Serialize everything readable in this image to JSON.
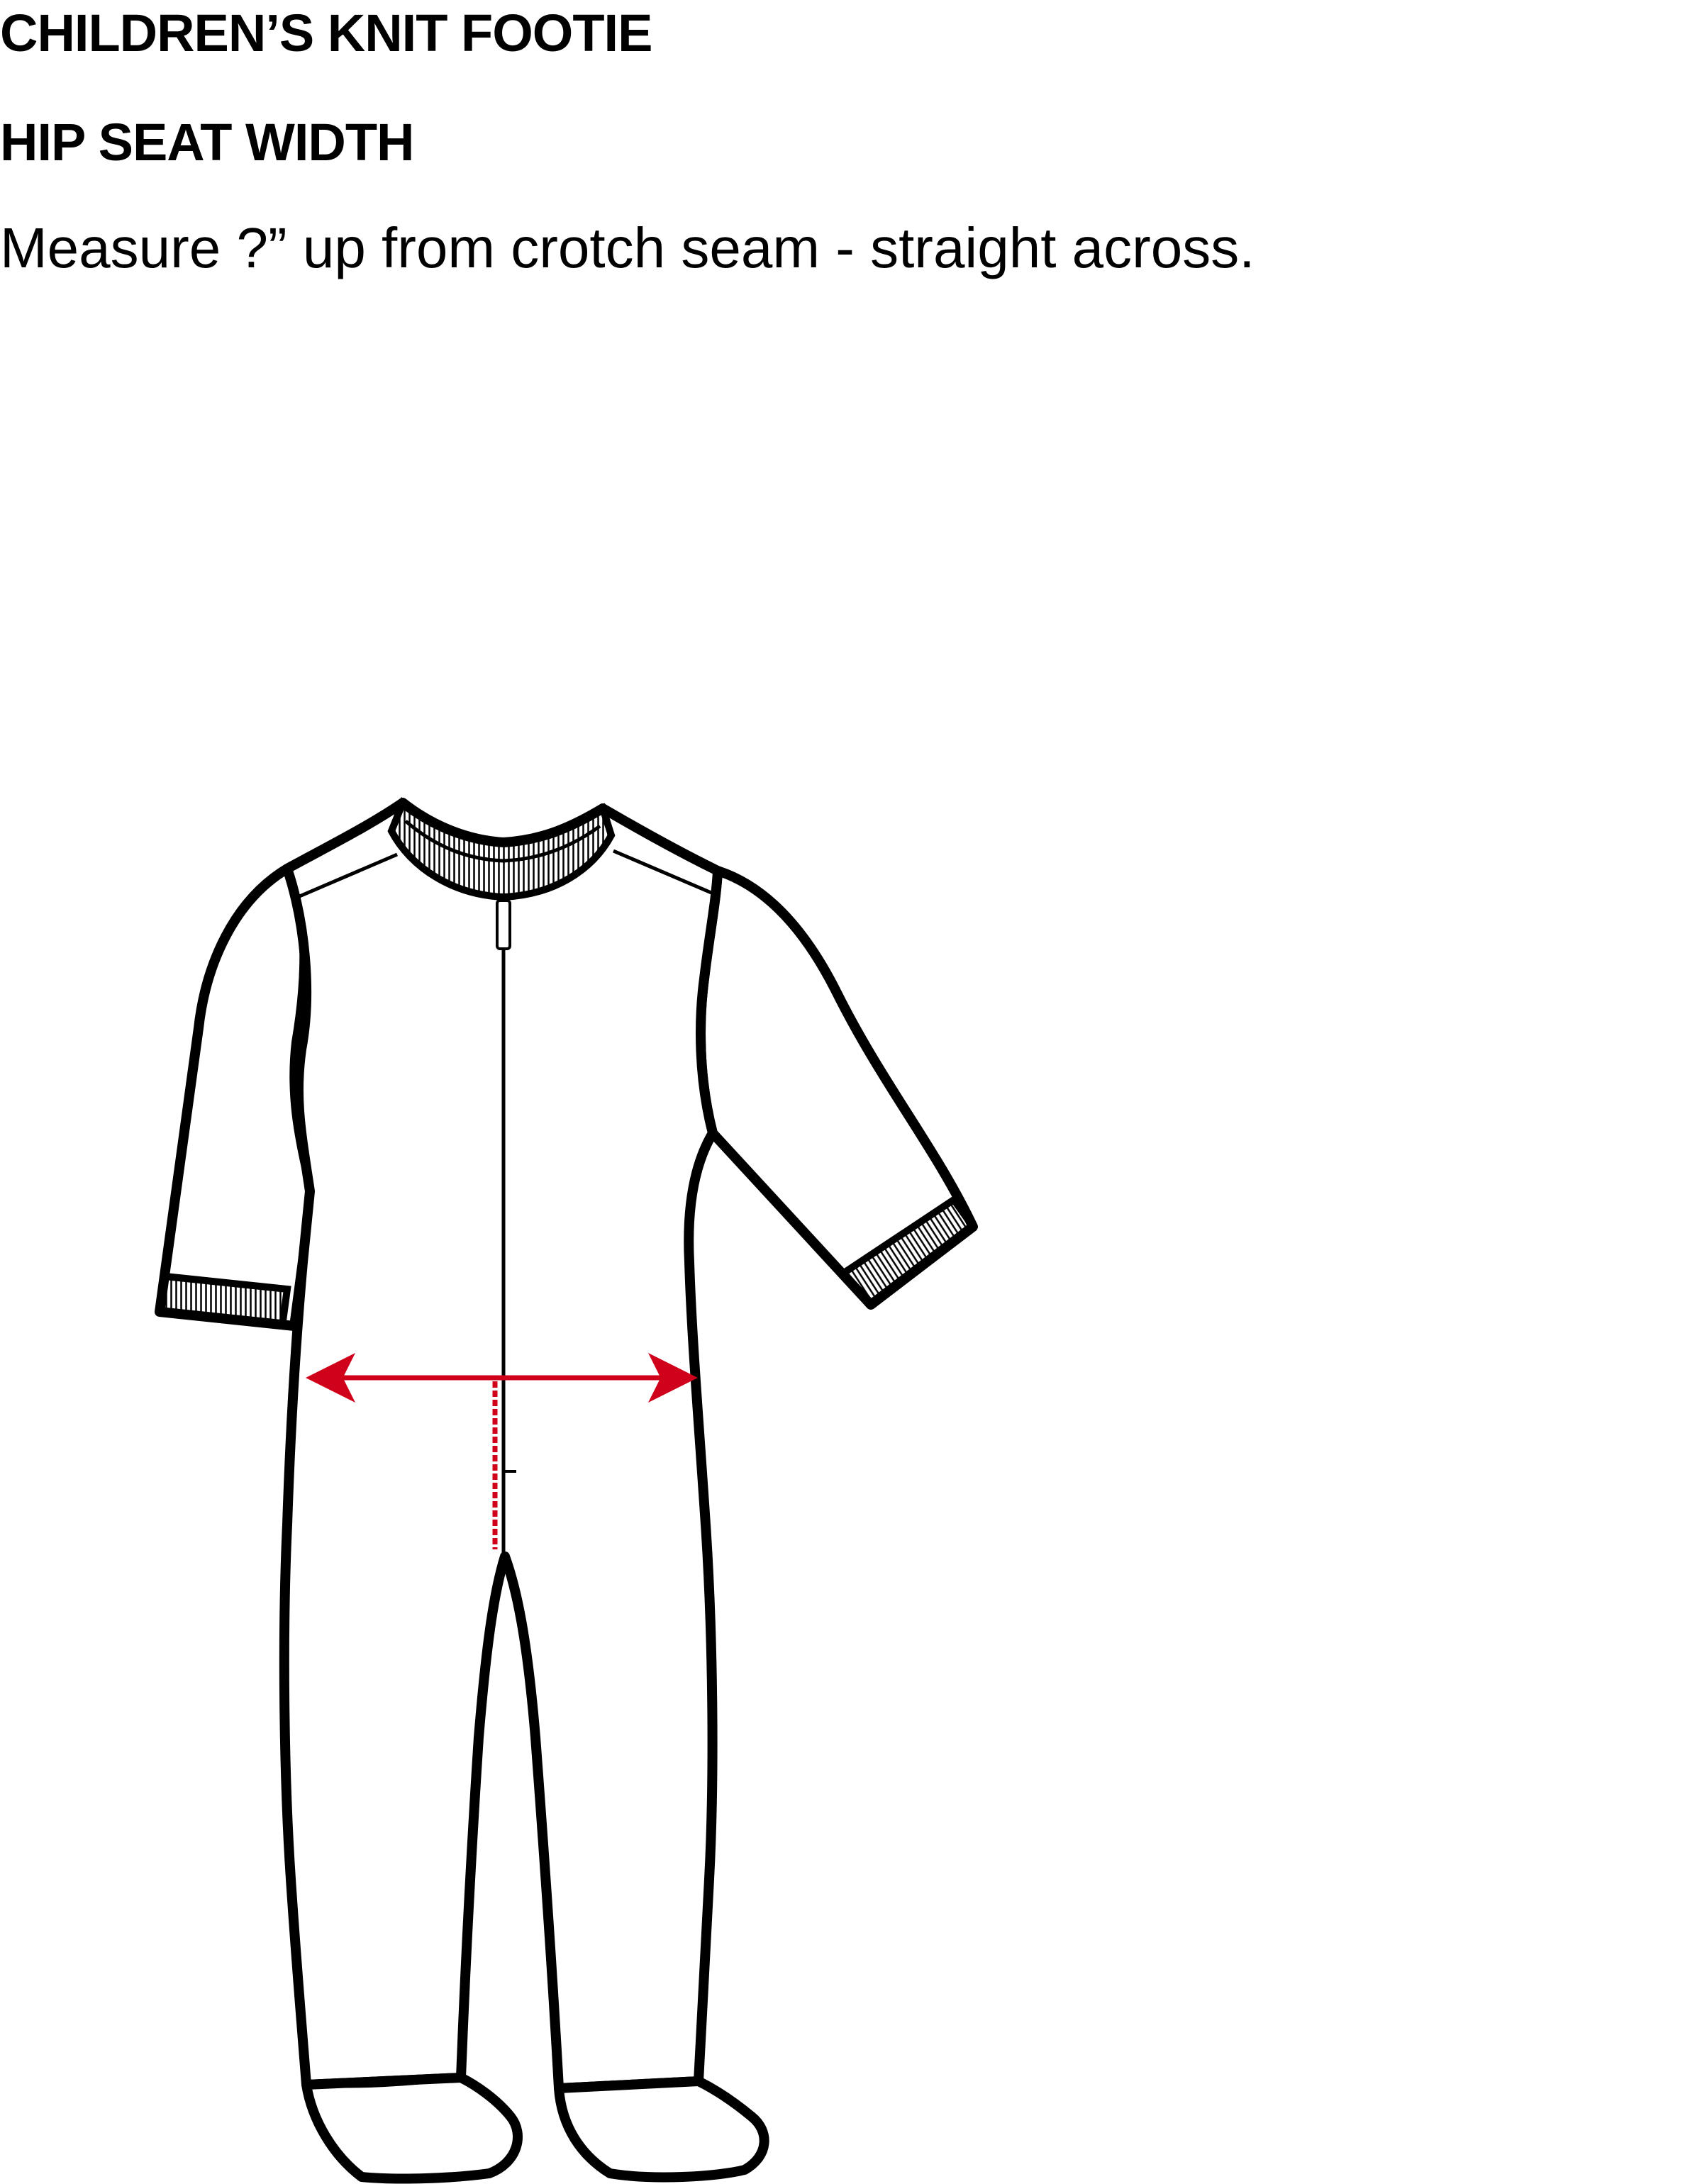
{
  "header": {
    "title": "CHILDREN’S KNIT FOOTIE",
    "subtitle": "HIP SEAT WIDTH",
    "instruction": "Measure ?” up from crotch seam - straight across."
  },
  "diagram": {
    "garment": "knit footie",
    "measurement": "hip seat width",
    "colors": {
      "outline": "#000000",
      "measure_arrow": "#d0021b",
      "background": "#ffffff"
    }
  }
}
